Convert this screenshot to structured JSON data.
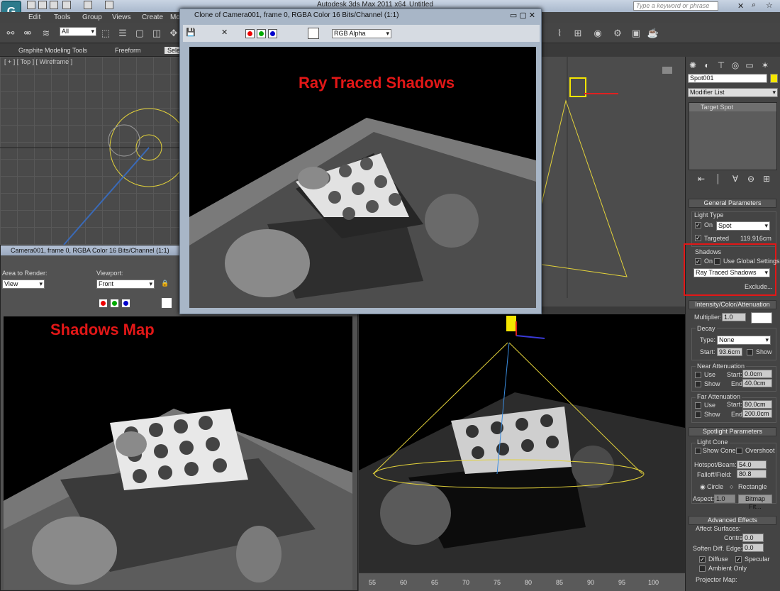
{
  "app": {
    "title": "Autodesk 3ds Max  2011 x64",
    "document": "Untitled",
    "logo": "G"
  },
  "search": {
    "placeholder": "Type a keyword or phrase"
  },
  "menu": [
    "Edit",
    "Tools",
    "Group",
    "Views",
    "Create",
    "Mo"
  ],
  "toolbar": {
    "filter": "All"
  },
  "ribbon": {
    "tabs": [
      "Graphite Modeling Tools",
      "Freeform",
      "Sele"
    ]
  },
  "viewports": {
    "top_label": "[ + ] [ Top ] [ Wireframe ]",
    "timeline_ticks": [
      "55",
      "60",
      "65",
      "70",
      "75",
      "80",
      "85",
      "90",
      "95",
      "100"
    ]
  },
  "render_window_1": {
    "title": "Clone of Camera001, frame 0, RGBA Color 16 Bits/Channel (1:1)",
    "channel": "RGB Alpha",
    "caption": "Ray Traced Shadows"
  },
  "render_window_2": {
    "title": "Camera001, frame 0, RGBA Color 16 Bits/Channel (1:1)",
    "area_label": "Area to Render:",
    "area_value": "View",
    "viewport_label": "Viewport:",
    "viewport_value": "Front",
    "caption": "Shadows Map"
  },
  "command_panel": {
    "object_name": "Spot001",
    "modifier_list": "Modifier List",
    "stack_item": "Target Spot",
    "general": {
      "title": "General Parameters",
      "light_type_label": "Light Type",
      "on_label": "On",
      "light_type": "Spot",
      "targeted_label": "Targeted",
      "target_dist": "119.916cm",
      "shadows_label": "Shadows",
      "shadows_on_label": "On",
      "global_label": "Use Global Settings",
      "shadow_type": "Ray Traced Shadows",
      "exclude": "Exclude..."
    },
    "intensity": {
      "title": "Intensity/Color/Attenuation",
      "multiplier_label": "Multiplier:",
      "multiplier": "1.0",
      "decay_label": "Decay",
      "type_label": "Type:",
      "type": "None",
      "start_label": "Start:",
      "start": "93.6cm",
      "show_label": "Show",
      "near_label": "Near Attenuation",
      "use_label": "Use",
      "near_start": "0.0cm",
      "near_end": "40.0cm",
      "end_label": "End:",
      "far_label": "Far Attenuation",
      "far_start": "80.0cm",
      "far_end": "200.0cm"
    },
    "spotlight": {
      "title": "Spotlight Parameters",
      "cone_label": "Light Cone",
      "show_cone": "Show Cone",
      "overshoot": "Overshoot",
      "hotspot_label": "Hotspot/Beam:",
      "hotspot": "54.0",
      "falloff_label": "Falloff/Field:",
      "falloff": "80.8",
      "circle": "Circle",
      "rectangle": "Rectangle",
      "aspect_label": "Aspect:",
      "aspect": "1.0",
      "bitmap": "Bitmap Fit..."
    },
    "advanced": {
      "title": "Advanced Effects",
      "affect_label": "Affect Surfaces:",
      "contrast_label": "Contrast:",
      "contrast": "0.0",
      "soften_label": "Soften Diff. Edge:",
      "soften": "0.0",
      "diffuse": "Diffuse",
      "specular": "Specular",
      "ambient": "Ambient Only",
      "projector": "Projector Map:"
    }
  },
  "colors": {
    "highlight_red": "#e21717",
    "object_color": "#f5e600"
  }
}
